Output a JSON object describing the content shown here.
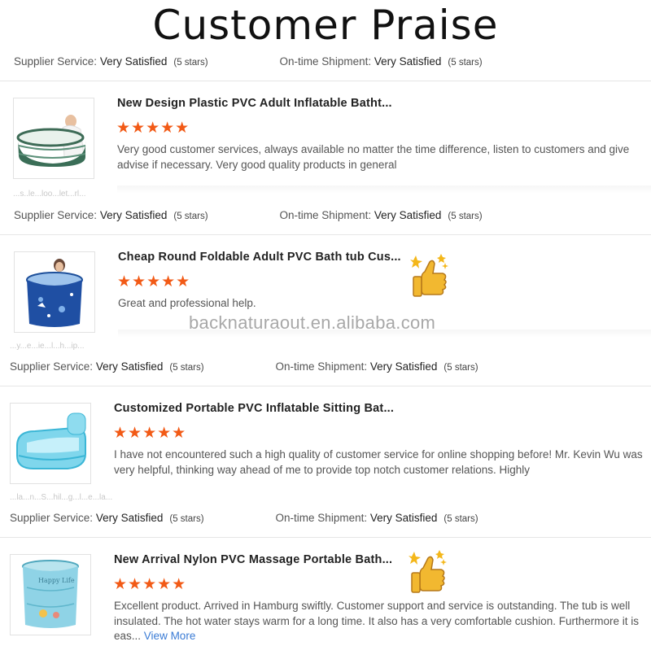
{
  "header": {
    "title": "Customer Praise"
  },
  "watermark": "backnaturaout.en.alibaba.com",
  "rating_labels": {
    "supplier_label": "Supplier Service:",
    "supplier_value": "Very Satisfied",
    "supplier_stars": "(5 stars)",
    "shipment_label": "On-time Shipment:",
    "shipment_value": "Very Satisfied",
    "shipment_stars": "(5 stars)"
  },
  "reviews": [
    {
      "product_title": "New Design Plastic PVC Adult Inflatable Batht...",
      "stars": "★★★★★",
      "rating": 5,
      "text": "Very good customer services, always available no matter the time difference, listen to customers and give advise if necessary. Very good quality products in general",
      "buyer": "...s..le...loo...let...rl...",
      "thumb_icon": "green-inflatable-bathtub-image"
    },
    {
      "product_title": "Cheap Round Foldable Adult PVC Bath tub Cus...",
      "stars": "★★★★★",
      "rating": 5,
      "text": "Great and professional help.",
      "buyer": "...y...e...ie...l...h...ip...",
      "thumb_icon": "blue-round-bathtub-image"
    },
    {
      "product_title": "Customized Portable PVC Inflatable Sitting Bat...",
      "stars": "★★★★★",
      "rating": 5,
      "text": "I have not encountered such a high quality of customer service for online shopping before!  Mr. Kevin Wu was very helpful, thinking way ahead of me to provide top notch customer relations.  Highly",
      "buyer": "...la...n...S...hil...g...l...e...la...",
      "thumb_icon": "cyan-inflatable-tub-image"
    },
    {
      "product_title": "New Arrival Nylon PVC Massage Portable Bath...",
      "stars": "★★★★★",
      "rating": 5,
      "text": "Excellent product. Arrived in Hamburg swiftly. Customer support and service is outstanding. The tub is well insulated. The hot water stays warm for a long time. It also has a very comfortable cushion. Furthermore it is eas...",
      "view_more": "View More",
      "thumb_icon": "folding-bucket-tub-image"
    }
  ]
}
